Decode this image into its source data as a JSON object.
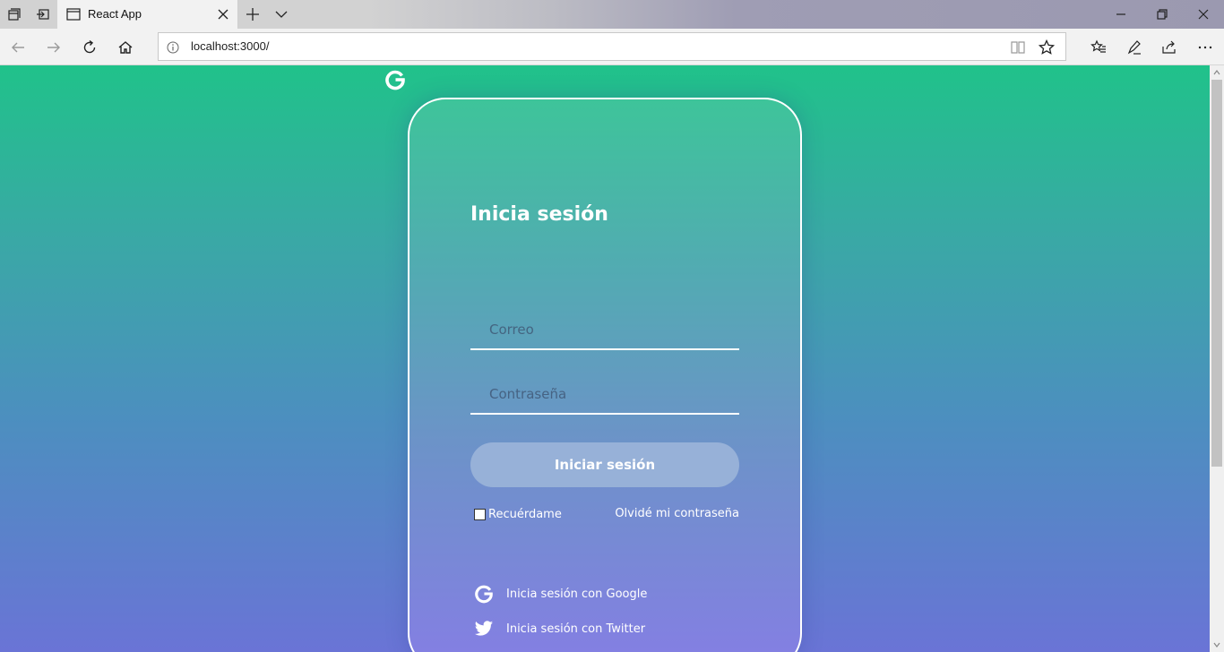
{
  "browser": {
    "tab_title": "React App",
    "url": "localhost:3000/"
  },
  "login": {
    "title": "Inicia sesión",
    "email_placeholder": "Correo",
    "password_placeholder": "Contraseña",
    "submit_label": "Iniciar sesión",
    "remember_label": "Recuérdame",
    "forgot_label": "Olvidé mi contraseña",
    "google_label": "Inicia sesión con Google",
    "twitter_label": "Inicia sesión con Twitter"
  },
  "colors": {
    "gradient_top": "#20c28a",
    "gradient_bottom": "#6a74d6",
    "button_bg": "#97b1d8",
    "text": "#ffffff"
  },
  "icons": {
    "logo": "google-g-icon",
    "google": "google-g-icon",
    "twitter": "twitter-bird-icon"
  }
}
